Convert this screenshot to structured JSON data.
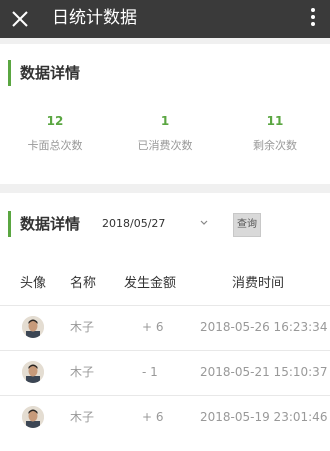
{
  "topbar": {
    "title": "日统计数据",
    "close_icon": "close-icon",
    "more_icon": "more-vertical-icon"
  },
  "summary": {
    "title": "数据详情",
    "stats": [
      {
        "value": "12",
        "label": "卡面总次数"
      },
      {
        "value": "1",
        "label": "已消费次数"
      },
      {
        "value": "11",
        "label": "剩余次数"
      }
    ]
  },
  "detail": {
    "title": "数据详情",
    "date": "2018/05/27",
    "query_label": "查询",
    "columns": [
      "头像",
      "名称",
      "发生金额",
      "消费时间"
    ],
    "rows": [
      {
        "name": "木子",
        "amount": "+ 6",
        "time": "2018-05-26 16:23:34"
      },
      {
        "name": "木子",
        "amount": "- 1",
        "time": "2018-05-21 15:10:37"
      },
      {
        "name": "木子",
        "amount": "+ 6",
        "time": "2018-05-19 23:01:46"
      }
    ]
  },
  "colors": {
    "accent": "#5aa641",
    "topbar": "#3a3a3a"
  }
}
